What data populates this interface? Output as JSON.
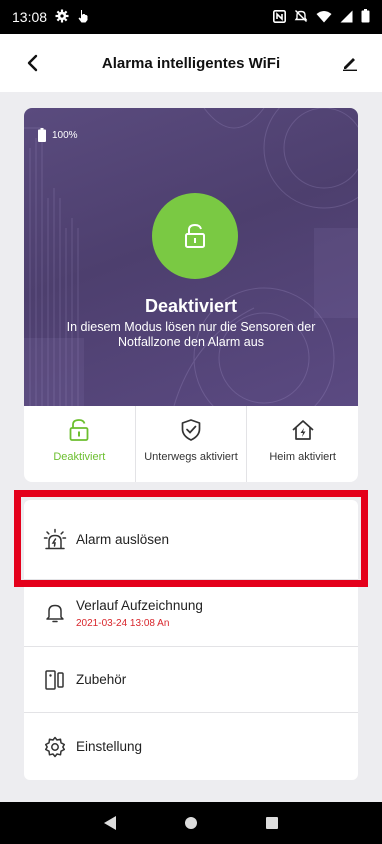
{
  "status_bar": {
    "time": "13:08"
  },
  "app_bar": {
    "title": "Alarma intelligentes WiFi"
  },
  "hero": {
    "battery_percent": "100%",
    "state_title": "Deaktiviert",
    "state_description": "In diesem Modus lösen nur die Sensoren der Notfallzone den Alarm aus"
  },
  "modes": [
    {
      "label": "Deaktiviert",
      "active": true
    },
    {
      "label": "Unterwegs aktiviert",
      "active": false
    },
    {
      "label": "Heim aktiviert",
      "active": false
    }
  ],
  "actions": [
    {
      "label": "Alarm auslösen"
    },
    {
      "label": "Verlauf Aufzeichnung",
      "sub": "2021-03-24 13:08 An"
    },
    {
      "label": "Zubehör"
    },
    {
      "label": "Einstellung"
    }
  ],
  "colors": {
    "accent_green": "#7ac943",
    "highlight_red": "#e4001b",
    "hero_purple": "#4d3f6e",
    "timestamp_red": "#d8262c"
  },
  "icons": {
    "status_left": [
      "gear-icon",
      "hand-touch-icon"
    ],
    "status_right": [
      "nfc-icon",
      "mute-icon",
      "wifi-icon",
      "signal-icon",
      "battery-icon"
    ],
    "nav": [
      "back-triangle-icon",
      "home-circle-icon",
      "recents-square-icon"
    ]
  }
}
